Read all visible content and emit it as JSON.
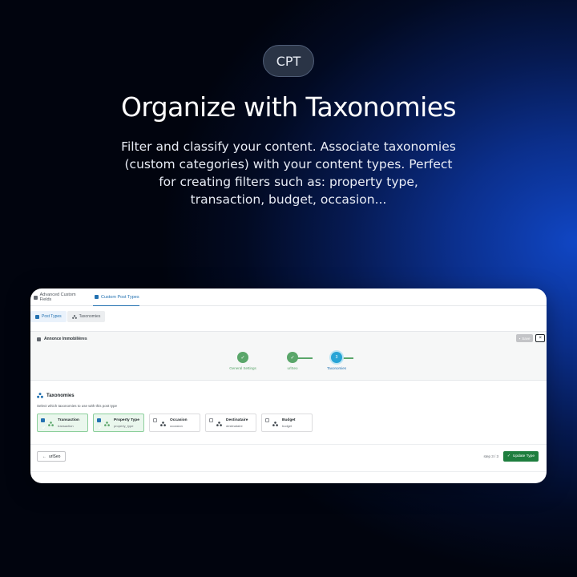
{
  "hero": {
    "badge": "CPT",
    "title": "Organize with Taxonomies",
    "subtitle": "Filter and classify your content. Associate taxonomies (custom categories) with your content types. Perfect for creating filters such as: property type, transaction, budget, occasion..."
  },
  "app": {
    "nav_tabs": [
      {
        "label": "Advanced Custom Fields",
        "icon": "grid-icon",
        "active": false
      },
      {
        "label": "Custom Post Types",
        "icon": "post-types-icon",
        "active": true
      }
    ],
    "sub_tabs": [
      {
        "label": "Post Types",
        "icon": "post-types-icon",
        "active": true
      },
      {
        "label": "Taxonomies",
        "icon": "taxonomy-icon",
        "active": false
      }
    ],
    "post_title": "Annonce Immobilières",
    "save_label": "Save",
    "close_label": "×",
    "steps": [
      {
        "label": "General Settings",
        "state": "done"
      },
      {
        "label": "urlSeo",
        "state": "done"
      },
      {
        "label": "Taxonomies",
        "state": "current",
        "number": "3"
      }
    ],
    "section_title": "Taxonomies",
    "section_hint": "Select which taxonomies to use with this post type",
    "taxonomies": [
      {
        "name": "Transaction",
        "slug": "transaction",
        "checked": true
      },
      {
        "name": "Property Type",
        "slug": "property_type",
        "checked": true
      },
      {
        "name": "Occasion",
        "slug": "occasion",
        "checked": false
      },
      {
        "name": "Destinataire",
        "slug": "destinataire",
        "checked": false
      },
      {
        "name": "Budget",
        "slug": "budget",
        "checked": false
      }
    ],
    "back_label": "urlSeo",
    "step_counter": "step 3 / 3",
    "update_label": "Update Type",
    "colors": {
      "accent": "#2271b1",
      "success": "#5aa66a",
      "update_button": "#1e7e3e",
      "current_step": "#26a4d6"
    }
  }
}
